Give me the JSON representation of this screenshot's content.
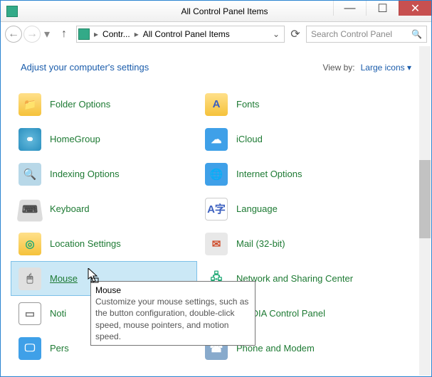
{
  "window": {
    "title": "All Control Panel Items"
  },
  "nav": {
    "breadcrumb1": "Contr...",
    "breadcrumb2": "All Control Panel Items",
    "search_placeholder": "Search Control Panel"
  },
  "header": {
    "heading": "Adjust your computer's settings",
    "viewby_label": "View by:",
    "viewby_value": "Large icons"
  },
  "items": [
    {
      "label": "Folder Options",
      "icon": "folder",
      "glyph": "📁"
    },
    {
      "label": "Fonts",
      "icon": "fonts",
      "glyph": "A"
    },
    {
      "label": "HomeGroup",
      "icon": "home",
      "glyph": "⚭"
    },
    {
      "label": "iCloud",
      "icon": "icloud",
      "glyph": "☁"
    },
    {
      "label": "Indexing Options",
      "icon": "idx",
      "glyph": "🔍"
    },
    {
      "label": "Internet Options",
      "icon": "inet",
      "glyph": "🌐"
    },
    {
      "label": "Keyboard",
      "icon": "kbd",
      "glyph": "⌨"
    },
    {
      "label": "Language",
      "icon": "lang",
      "glyph": "A字"
    },
    {
      "label": "Location Settings",
      "icon": "loc",
      "glyph": "◎"
    },
    {
      "label": "Mail (32-bit)",
      "icon": "mail",
      "glyph": "✉"
    },
    {
      "label": "Mouse",
      "icon": "mouse",
      "glyph": "🖱"
    },
    {
      "label": "Network and Sharing Center",
      "icon": "net",
      "glyph": "🖧"
    },
    {
      "label": "Noti",
      "icon": "noti",
      "glyph": "▭"
    },
    {
      "label": "NVIDIA Control Panel",
      "icon": "nvidia",
      "glyph": "◉"
    },
    {
      "label": "Pers",
      "icon": "pers",
      "glyph": "🖵"
    },
    {
      "label": "Phone and Modem",
      "icon": "phone",
      "glyph": "☎"
    }
  ],
  "hovered_index": 10,
  "tooltip": {
    "title": "Mouse",
    "body": "Customize your mouse settings, such as the button configuration, double-click speed, mouse pointers, and motion speed."
  }
}
